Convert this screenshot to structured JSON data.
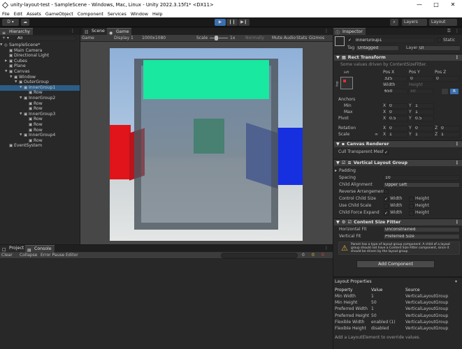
{
  "window": {
    "title": "unity-layout-test - SampleScene - Windows, Mac, Linux - Unity 2022.3.15f1* <DX11>",
    "minimize": "—",
    "maximize": "□",
    "close": "✕"
  },
  "menu": [
    "File",
    "Edit",
    "Assets",
    "GameObject",
    "Component",
    "Services",
    "Window",
    "Help"
  ],
  "toolbar": {
    "account": "D ▾",
    "cloud": "☁",
    "play": "▶",
    "pause": "❙❙",
    "step": "▶❙",
    "search": "⌕",
    "layers": "Layers",
    "layout": "Layout"
  },
  "hierarchy": {
    "tab": "Hierarchy",
    "add": "+ ▾",
    "search": "All",
    "items": [
      {
        "label": "SampleScene*",
        "depth": 0,
        "arrow": "▼",
        "icon": "◎"
      },
      {
        "label": "Main Camera",
        "depth": 1,
        "arrow": "",
        "icon": "▣"
      },
      {
        "label": "Directional Light",
        "depth": 1,
        "arrow": "",
        "icon": "▣"
      },
      {
        "label": "Cubes",
        "depth": 1,
        "arrow": "▶",
        "icon": "▣"
      },
      {
        "label": "Plane",
        "depth": 1,
        "arrow": "",
        "icon": "▣"
      },
      {
        "label": "Canvas",
        "depth": 1,
        "arrow": "▼",
        "icon": "▣"
      },
      {
        "label": "Window",
        "depth": 2,
        "arrow": "▼",
        "icon": "▣"
      },
      {
        "label": "OuterGroup",
        "depth": 3,
        "arrow": "▼",
        "icon": "▣"
      },
      {
        "label": "InnerGroup1",
        "depth": 4,
        "arrow": "▼",
        "icon": "▣",
        "selected": true
      },
      {
        "label": "Row",
        "depth": 5,
        "arrow": "",
        "icon": "▣"
      },
      {
        "label": "InnerGroup2",
        "depth": 4,
        "arrow": "▼",
        "icon": "▣"
      },
      {
        "label": "Row",
        "depth": 5,
        "arrow": "",
        "icon": "▣"
      },
      {
        "label": "Row",
        "depth": 5,
        "arrow": "",
        "icon": "▣"
      },
      {
        "label": "InnerGroup3",
        "depth": 4,
        "arrow": "▼",
        "icon": "▣"
      },
      {
        "label": "Row",
        "depth": 5,
        "arrow": "",
        "icon": "▣"
      },
      {
        "label": "Row",
        "depth": 5,
        "arrow": "",
        "icon": "▣"
      },
      {
        "label": "Row",
        "depth": 5,
        "arrow": "",
        "icon": "▣"
      },
      {
        "label": "InnerGroup4",
        "depth": 4,
        "arrow": "▼",
        "icon": "▣"
      },
      {
        "label": "Row",
        "depth": 5,
        "arrow": "",
        "icon": "▣"
      },
      {
        "label": "EventSystem",
        "depth": 1,
        "arrow": "",
        "icon": "▣"
      }
    ]
  },
  "scene_tabs": {
    "scene": "Scene",
    "game": "Game"
  },
  "game_toolbar": {
    "game": "Game",
    "display": "Display 1",
    "resolution": "1000x1080",
    "scale_label": "Scale",
    "scale_value": "1x",
    "normally": "Normally",
    "mute": "Mute Audio",
    "stats": "Stats",
    "gizmos": "Gizmos"
  },
  "bottom": {
    "project_tab": "Project",
    "console_tab": "Console",
    "clear": "Clear",
    "collapse": "Collapse",
    "error_pause": "Error Pause",
    "editor": "Editor",
    "count_log": "0",
    "count_warn": "0",
    "count_err": "0"
  },
  "inspector": {
    "tab": "Inspector",
    "object_name": "InnerGroup1",
    "static_label": "Static",
    "tag_label": "Tag",
    "tag_value": "Untagged",
    "layer_label": "Layer",
    "layer_value": "UI",
    "rect_transform": {
      "title": "Rect Transform",
      "note": "Some values driven by ContentSizeFitter.",
      "anchor_left": "left",
      "anchor_top": "top",
      "pos_x_label": "Pos X",
      "pos_y_label": "Pos Y",
      "pos_z_label": "Pos Z",
      "pos_x": "325",
      "pos_y": "0",
      "pos_z": "0",
      "width_label": "Width",
      "height_label": "Height",
      "width": "650",
      "height": "50",
      "anchors_label": "Anchors",
      "min_label": "Min",
      "max_label": "Max",
      "pivot_label": "Pivot",
      "min_x": "0",
      "min_y": "1",
      "max_x": "0",
      "max_y": "1",
      "pivot_x": "0.5",
      "pivot_y": "0.5",
      "rotation_label": "Rotation",
      "scale_label": "Scale",
      "rot_x": "0",
      "rot_y": "0",
      "rot_z": "0",
      "scale_x": "1",
      "scale_y": "1",
      "scale_z": "1",
      "x": "X",
      "y": "Y",
      "z": "Z",
      "r_btn": "R"
    },
    "canvas_renderer": {
      "title": "Canvas Renderer",
      "cull_label": "Cull Transparent Mesh"
    },
    "vlg": {
      "title": "Vertical Layout Group",
      "padding": "Padding",
      "spacing_label": "Spacing",
      "spacing": "10",
      "child_alignment_label": "Child Alignment",
      "child_alignment": "Upper Left",
      "reverse": "Reverse Arrangement",
      "control": "Control Child Size",
      "use_scale": "Use Child Scale",
      "expand": "Child Force Expand",
      "width": "Width",
      "height": "Height"
    },
    "csf": {
      "title": "Content Size Fitter",
      "hfit_label": "Horizontal Fit",
      "hfit": "Unconstrained",
      "vfit_label": "Vertical Fit",
      "vfit": "Preferred Size",
      "warning": "Parent has a type of layout group component. A child of a layout group should not have a Content Size Fitter component, since it should be driven by the layout group."
    },
    "add_component": "Add Component",
    "layout_properties": {
      "title": "Layout Properties",
      "headers": [
        "Property",
        "Value",
        "Source"
      ],
      "rows": [
        [
          "Min Width",
          "1",
          "VerticalLayoutGroup"
        ],
        [
          "Min Height",
          "50",
          "VerticalLayoutGroup"
        ],
        [
          "Preferred Width",
          "1",
          "VerticalLayoutGroup"
        ],
        [
          "Preferred Height",
          "50",
          "VerticalLayoutGroup"
        ],
        [
          "Flexible Width",
          "enabled (1)",
          "VerticalLayoutGroup"
        ],
        [
          "Flexible Height",
          "disabled",
          "VerticalLayoutGroup"
        ]
      ],
      "footer": "Add a LayoutElement to override values."
    }
  },
  "icons": {
    "settings": "⚙",
    "kebab": "⋮",
    "lock": "🔒",
    "help": "?",
    "warning": "⚠",
    "dropdown": "▾",
    "search": "⌕"
  },
  "colors": {
    "accent_blue": "#3a6fb0",
    "selection": "#2c5d87",
    "bg": "#282828",
    "header": "#3e3e3e",
    "teal": "#19e8a0"
  }
}
